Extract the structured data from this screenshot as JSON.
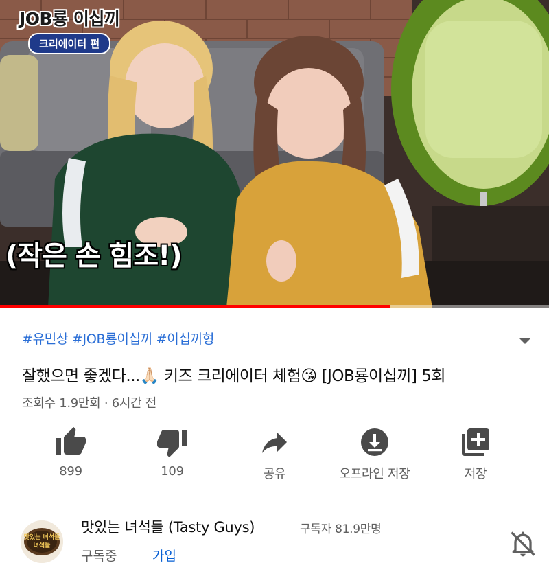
{
  "video": {
    "overlay_title": "JOB룡 이십끼",
    "overlay_subtitle": "크리에이터 편",
    "caption": "(작은 손 힘조!)",
    "progress_fraction": 0.71,
    "progress_color": "#ff0000"
  },
  "hashtags": "#유민상 #JOB룡이십끼 #이십끼형",
  "title": "잘했으면 좋겠다...🙏🏻 키즈 크리에이터 체험😘 [JOB룡이십끼] 5회",
  "views": "조회수 1.9만회 · 6시간 전",
  "actions": [
    {
      "icon": "thumbs-up-icon",
      "label": "899"
    },
    {
      "icon": "thumbs-down-icon",
      "label": "109"
    },
    {
      "icon": "share-icon",
      "label": "공유"
    },
    {
      "icon": "download-icon",
      "label": "오프라인 저장"
    },
    {
      "icon": "add-to-playlist-icon",
      "label": "저장"
    }
  ],
  "channel": {
    "name": "맛있는 녀석들 (Tasty Guys)",
    "subscribers": "구독자 81.9만명",
    "subscribed_label": "구독중",
    "join_label": "가입",
    "avatar_icon": "channel-logo-icon",
    "avatar_text": "맛있는 녀석들",
    "bell_icon": "notifications-off-icon"
  },
  "colors": {
    "accent_blue": "#065fd4",
    "hashtag_blue": "#2a6ed6",
    "secondary_text": "#606060",
    "icon_dark": "#4a4a4a"
  }
}
